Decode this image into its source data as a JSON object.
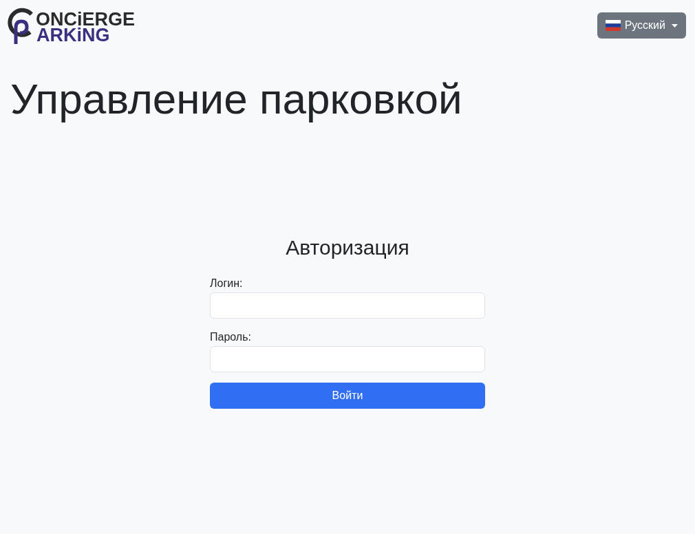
{
  "header": {
    "logo": {
      "line_1": "ONCiERGE",
      "line_2": "ARKiNG"
    },
    "language_button": {
      "label": "Русский"
    }
  },
  "page_title": "Управление парковкой",
  "login_form": {
    "title": "Авторизация",
    "fields": [
      {
        "label": "Логин:"
      },
      {
        "label": "Пароль:"
      }
    ],
    "submit_button": "Войти"
  }
}
